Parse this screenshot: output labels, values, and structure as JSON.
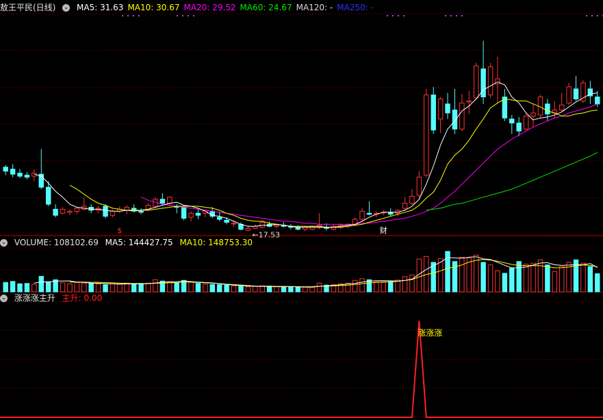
{
  "colors": {
    "up": "#ff3232",
    "down": "#54fcfc",
    "ma5": "#ffffff",
    "ma10": "#ffff00",
    "ma20": "#ff00ff",
    "ma60": "#00e600",
    "ma250": "#3030ff",
    "grid": "#8b0000",
    "indicator": "#ff2020"
  },
  "price_panel": {
    "title": "敖王平民(日线)",
    "ma_labels": [
      {
        "text": "MA5: 31.63",
        "color": "#ffffff"
      },
      {
        "text": "MA10: 30.67",
        "color": "#ffff00"
      },
      {
        "text": "MA20: 29.52",
        "color": "#ff00ff"
      },
      {
        "text": "MA60: 24.67",
        "color": "#00e600"
      },
      {
        "text": "MA120: -",
        "color": "#dddddd"
      },
      {
        "text": "MA250: -",
        "color": "#3030ff"
      }
    ],
    "low_annotation": "←17.53",
    "markers": [
      {
        "text": "$",
        "index": 16,
        "color": "#ff3030"
      },
      {
        "text": "财",
        "index": 53,
        "color": "#ffffff"
      }
    ]
  },
  "volume_panel": {
    "title": "VOLUME: 108102.69",
    "ma5": "MA5: 144427.75",
    "ma10": "MA10: 148753.30"
  },
  "indicator_panel": {
    "title": "涨涨涨主升",
    "value_label": "主升: 0.00",
    "signal_text": "涨涨涨"
  },
  "chart_data": [
    {
      "type": "candlestick",
      "title": "敖王平民(日线)",
      "y_range": [
        16.5,
        38.5
      ],
      "dates": [],
      "ohlc": [
        [
          23.2,
          23.4,
          22.4,
          22.8
        ],
        [
          23.0,
          23.5,
          22.2,
          22.5
        ],
        [
          22.6,
          23.0,
          22.1,
          22.3
        ],
        [
          22.4,
          22.7,
          22.0,
          22.2
        ],
        [
          22.3,
          23.0,
          21.8,
          22.6
        ],
        [
          22.5,
          25.0,
          21.0,
          21.2
        ],
        [
          21.2,
          21.8,
          19.3,
          19.5
        ],
        [
          19.0,
          19.5,
          18.2,
          18.4
        ],
        [
          18.6,
          19.2,
          18.5,
          19.0
        ],
        [
          18.7,
          19.0,
          18.4,
          18.8
        ],
        [
          18.8,
          19.2,
          18.5,
          19.1
        ],
        [
          19.0,
          20.2,
          18.9,
          19.3
        ],
        [
          19.2,
          19.5,
          18.6,
          18.9
        ],
        [
          18.9,
          19.3,
          18.6,
          19.1
        ],
        [
          19.3,
          19.5,
          18.1,
          18.3
        ],
        [
          18.4,
          19.0,
          18.2,
          18.8
        ],
        [
          18.8,
          19.3,
          18.6,
          19.0
        ],
        [
          18.9,
          19.4,
          18.5,
          19.2
        ],
        [
          19.1,
          19.5,
          18.7,
          18.9
        ],
        [
          18.8,
          19.1,
          18.5,
          18.7
        ],
        [
          19.0,
          19.6,
          18.8,
          19.4
        ],
        [
          19.3,
          20.2,
          19.1,
          20.0
        ],
        [
          20.0,
          20.6,
          19.4,
          19.6
        ],
        [
          19.6,
          20.3,
          19.3,
          20.2
        ],
        [
          19.3,
          19.5,
          18.6,
          19.2
        ],
        [
          19.2,
          19.3,
          17.9,
          18.1
        ],
        [
          18.2,
          18.8,
          17.8,
          18.6
        ],
        [
          18.6,
          19.0,
          18.0,
          18.4
        ],
        [
          18.6,
          19.0,
          18.2,
          18.9
        ],
        [
          18.8,
          19.2,
          18.1,
          18.3
        ],
        [
          18.2,
          18.7,
          17.8,
          18.0
        ],
        [
          17.9,
          18.2,
          17.5,
          17.7
        ],
        [
          17.6,
          17.9,
          17.2,
          17.6
        ],
        [
          17.5,
          17.7,
          16.9,
          17.0
        ],
        [
          16.9,
          17.4,
          16.8,
          17.1
        ],
        [
          17.1,
          17.5,
          17.0,
          17.3
        ],
        [
          17.2,
          17.9,
          17.1,
          17.7
        ],
        [
          17.5,
          17.8,
          17.2,
          17.3
        ],
        [
          17.3,
          17.6,
          17.1,
          17.4
        ],
        [
          17.4,
          17.7,
          17.2,
          17.3
        ],
        [
          17.3,
          17.5,
          17.0,
          17.2
        ],
        [
          17.2,
          17.4,
          16.9,
          17.0
        ],
        [
          17.0,
          17.3,
          16.8,
          17.2
        ],
        [
          17.0,
          17.4,
          16.9,
          17.3
        ],
        [
          17.2,
          18.6,
          17.0,
          17.4
        ],
        [
          17.2,
          17.6,
          16.9,
          17.1
        ],
        [
          17.0,
          17.5,
          16.9,
          17.3
        ],
        [
          17.2,
          17.6,
          17.0,
          17.4
        ],
        [
          17.3,
          17.6,
          17.1,
          17.5
        ],
        [
          17.5,
          18.2,
          17.3,
          18.0
        ],
        [
          18.0,
          19.1,
          17.8,
          18.8
        ],
        [
          18.6,
          19.8,
          18.4,
          18.5
        ],
        [
          18.5,
          18.8,
          18.2,
          18.6
        ],
        [
          18.7,
          18.9,
          18.4,
          18.7
        ],
        [
          18.7,
          19.1,
          18.3,
          18.5
        ],
        [
          18.6,
          19.0,
          18.3,
          18.9
        ],
        [
          19.1,
          20.2,
          18.9,
          19.6
        ],
        [
          19.6,
          21.0,
          19.4,
          20.3
        ],
        [
          20.4,
          22.8,
          20.0,
          22.2
        ],
        [
          22.4,
          31.0,
          22.2,
          30.4
        ],
        [
          30.4,
          31.2,
          26.5,
          26.9
        ],
        [
          28.0,
          30.2,
          26.6,
          30.0
        ],
        [
          29.5,
          30.6,
          28.0,
          28.6
        ],
        [
          28.9,
          31.0,
          26.5,
          27.0
        ],
        [
          27.0,
          30.5,
          26.8,
          29.6
        ],
        [
          29.7,
          30.8,
          28.5,
          29.8
        ],
        [
          30.1,
          33.6,
          29.9,
          33.3
        ],
        [
          33.0,
          35.8,
          29.5,
          30.2
        ],
        [
          30.4,
          33.6,
          30.1,
          33.2
        ],
        [
          31.5,
          34.2,
          29.6,
          32.0
        ],
        [
          30.2,
          31.0,
          27.8,
          28.1
        ],
        [
          28.0,
          28.4,
          26.5,
          27.6
        ],
        [
          27.6,
          28.2,
          26.3,
          26.8
        ],
        [
          27.0,
          28.5,
          26.8,
          28.3
        ],
        [
          28.3,
          29.5,
          27.2,
          28.6
        ],
        [
          28.4,
          30.4,
          28.1,
          30.2
        ],
        [
          29.5,
          30.0,
          27.8,
          28.5
        ],
        [
          28.6,
          29.8,
          28.1,
          28.9
        ],
        [
          28.9,
          30.6,
          28.7,
          29.4
        ],
        [
          29.6,
          31.6,
          29.4,
          31.2
        ],
        [
          31.0,
          32.3,
          29.8,
          30.0
        ],
        [
          29.8,
          31.9,
          29.6,
          31.6
        ],
        [
          31.0,
          31.8,
          29.5,
          30.3
        ],
        [
          30.2,
          30.8,
          29.2,
          29.5
        ]
      ],
      "ma5": [
        null,
        null,
        null,
        null,
        22.5,
        22.3,
        21.6,
        20.8,
        20.2,
        19.5,
        19.2,
        19.1,
        19.0,
        19.0,
        18.9,
        18.8,
        18.8,
        18.9,
        18.8,
        18.9,
        19.0,
        19.2,
        19.4,
        19.6,
        19.7,
        19.4,
        19.3,
        19.1,
        18.8,
        18.4,
        18.3,
        18.1,
        17.8,
        17.5,
        17.3,
        17.3,
        17.4,
        17.4,
        17.5,
        17.4,
        17.3,
        17.2,
        17.2,
        17.2,
        17.2,
        17.2,
        17.2,
        17.3,
        17.4,
        17.5,
        17.8,
        18.2,
        18.5,
        18.7,
        18.7,
        18.7,
        18.9,
        19.3,
        20.0,
        21.5,
        23.3,
        25.4,
        27.0,
        27.8,
        28.8,
        29.3,
        30.0,
        30.9,
        31.3,
        31.7,
        31.4,
        30.2,
        29.6,
        28.6,
        27.9,
        28.1,
        28.2,
        28.4,
        28.7,
        29.2,
        29.7,
        30.1,
        30.5,
        30.6
      ],
      "ma10": [
        null,
        null,
        null,
        null,
        null,
        null,
        null,
        null,
        null,
        21.4,
        21.0,
        20.5,
        20.0,
        19.6,
        19.4,
        19.1,
        19.0,
        18.9,
        18.9,
        18.9,
        18.9,
        19.0,
        19.1,
        19.2,
        19.3,
        19.3,
        19.3,
        19.3,
        19.2,
        19.1,
        18.9,
        18.6,
        18.4,
        18.1,
        17.9,
        17.8,
        17.8,
        17.6,
        17.5,
        17.4,
        17.3,
        17.3,
        17.3,
        17.3,
        17.3,
        17.2,
        17.2,
        17.2,
        17.3,
        17.4,
        17.5,
        17.7,
        17.9,
        18.1,
        18.3,
        18.5,
        18.7,
        18.9,
        19.4,
        20.1,
        20.7,
        21.9,
        23.5,
        24.4,
        25.0,
        25.9,
        27.0,
        28.0,
        29.1,
        29.6,
        30.0,
        29.9,
        29.8,
        29.8,
        29.5,
        29.2,
        28.8,
        28.6,
        28.3,
        28.3,
        28.5,
        28.6,
        28.8,
        28.9
      ],
      "ma20": [
        null,
        null,
        null,
        null,
        null,
        null,
        null,
        null,
        null,
        null,
        null,
        null,
        null,
        null,
        null,
        null,
        null,
        null,
        null,
        20.2,
        19.9,
        19.7,
        19.5,
        19.4,
        19.3,
        19.2,
        19.1,
        19.0,
        18.9,
        18.8,
        18.7,
        18.6,
        18.5,
        18.4,
        18.3,
        18.2,
        18.1,
        18.0,
        17.9,
        17.8,
        17.8,
        17.7,
        17.6,
        17.6,
        17.5,
        17.5,
        17.5,
        17.5,
        17.5,
        17.5,
        17.6,
        17.6,
        17.7,
        17.8,
        17.9,
        18.0,
        18.1,
        18.3,
        18.5,
        18.8,
        19.1,
        19.6,
        20.2,
        20.8,
        21.5,
        22.2,
        22.9,
        23.6,
        24.3,
        25.0,
        25.5,
        26.0,
        26.4,
        26.8,
        27.2,
        27.5,
        27.8,
        28.1,
        28.3,
        28.6,
        28.8,
        29.0,
        29.2,
        29.5
      ],
      "ma60": [
        null,
        null,
        null,
        null,
        null,
        null,
        null,
        null,
        null,
        null,
        null,
        null,
        null,
        null,
        null,
        null,
        null,
        null,
        null,
        null,
        null,
        null,
        null,
        null,
        null,
        null,
        null,
        null,
        null,
        null,
        null,
        null,
        null,
        null,
        null,
        null,
        null,
        null,
        null,
        null,
        null,
        null,
        null,
        null,
        null,
        null,
        null,
        null,
        null,
        null,
        null,
        null,
        null,
        null,
        null,
        null,
        null,
        null,
        null,
        18.9,
        19.0,
        19.1,
        19.3,
        19.5,
        19.6,
        19.8,
        20.0,
        20.2,
        20.4,
        20.6,
        20.8,
        21.0,
        21.3,
        21.6,
        21.9,
        22.2,
        22.5,
        22.8,
        23.1,
        23.4,
        23.7,
        24.0,
        24.3,
        24.67
      ],
      "volume_y_range": [
        0,
        260000
      ],
      "volume": [
        56000,
        62000,
        48000,
        50000,
        45000,
        92000,
        60000,
        72000,
        54000,
        48000,
        56000,
        52000,
        50000,
        47000,
        43000,
        48000,
        45000,
        52000,
        48000,
        46000,
        52000,
        72000,
        64000,
        60000,
        55000,
        68000,
        58000,
        50000,
        46000,
        44000,
        42000,
        40000,
        36000,
        34000,
        30000,
        33000,
        36000,
        34000,
        30000,
        29000,
        28000,
        27000,
        28000,
        29000,
        52000,
        40000,
        43000,
        48000,
        52000,
        68000,
        78000,
        72000,
        60000,
        56000,
        62000,
        70000,
        90000,
        100000,
        195000,
        210000,
        175000,
        198000,
        240000,
        180000,
        205000,
        200000,
        218000,
        175000,
        160000,
        125000,
        110000,
        140000,
        180000,
        165000,
        170000,
        190000,
        160000,
        120000,
        150000,
        175000,
        190000,
        170000,
        150000,
        108102.69
      ],
      "volume_ma5": [
        null,
        null,
        null,
        null,
        52200,
        59400,
        59000,
        63800,
        64600,
        65200,
        58000,
        56400,
        52000,
        50600,
        49800,
        48000,
        46600,
        47000,
        47200,
        47800,
        48600,
        52800,
        56400,
        59200,
        60600,
        63800,
        61000,
        58200,
        55400,
        53200,
        48000,
        44400,
        40400,
        37200,
        34600,
        33400,
        33800,
        33400,
        32600,
        32400,
        31400,
        29600,
        28400,
        28200,
        33000,
        35200,
        38400,
        42400,
        47000,
        50200,
        57800,
        63600,
        66000,
        66800,
        65600,
        64000,
        67600,
        75600,
        105400,
        133000,
        156000,
        175600,
        203600,
        201600,
        199600,
        205600,
        208600,
        195600,
        191600,
        175600,
        157600,
        142000,
        143000,
        147000,
        159000,
        171000,
        173000,
        161000,
        157000,
        159000,
        161000,
        161000,
        168000,
        144427.75
      ],
      "volume_ma10": [
        null,
        null,
        null,
        null,
        null,
        null,
        null,
        null,
        null,
        58700,
        58700,
        57700,
        56500,
        56700,
        54700,
        53900,
        52200,
        50400,
        49800,
        49500,
        49200,
        51200,
        52600,
        53900,
        54700,
        58100,
        57600,
        55600,
        53900,
        51600,
        49000,
        45800,
        43000,
        40500,
        37800,
        34600,
        32400,
        31700,
        31000,
        30500,
        31100,
        30700,
        30600,
        30700,
        33700,
        34400,
        35800,
        37500,
        39700,
        43800,
        48600,
        53000,
        56300,
        59000,
        60700,
        62700,
        67900,
        73100,
        89000,
        103100,
        111900,
        124800,
        139600,
        148000,
        159600,
        176900,
        187300,
        192300,
        188900,
        182100,
        172100,
        162400,
        156600,
        155100,
        155400,
        155400,
        149600,
        142400,
        143100,
        147600,
        155400,
        159400,
        156900,
        148753.3
      ],
      "indicator_y_range": [
        0,
        1.2
      ],
      "indicator": [
        0,
        0,
        0,
        0,
        0,
        0,
        0,
        0,
        0,
        0,
        0,
        0,
        0,
        0,
        0,
        0,
        0,
        0,
        0,
        0,
        0,
        0,
        0,
        0,
        0,
        0,
        0,
        0,
        0,
        0,
        0,
        0,
        0,
        0,
        0,
        0,
        0,
        0,
        0,
        0,
        0,
        0,
        0,
        0,
        0,
        0,
        0,
        0,
        0,
        0,
        0,
        0,
        0,
        0,
        0,
        0,
        0,
        0,
        1,
        0,
        0,
        0,
        0,
        0,
        0,
        0,
        0,
        0,
        0,
        0,
        0,
        0,
        0,
        0,
        0,
        0,
        0,
        0,
        0,
        0,
        0,
        0,
        0,
        0
      ]
    }
  ]
}
